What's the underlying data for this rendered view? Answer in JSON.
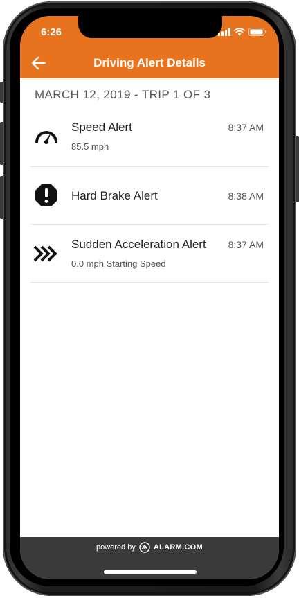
{
  "status_bar": {
    "time": "6:26",
    "icons": [
      "signal-icon",
      "wifi-icon",
      "battery-icon"
    ]
  },
  "header": {
    "title": "Driving Alert Details",
    "back_icon": "arrow-left-icon",
    "color": "#e8731f"
  },
  "trip": {
    "heading": "MARCH 12, 2019 - TRIP 1 OF 3"
  },
  "alerts": [
    {
      "title": "Speed Alert",
      "subtitle": "85.5 mph",
      "time": "8:37 AM",
      "icon": "speedometer-icon"
    },
    {
      "title": "Hard Brake Alert",
      "subtitle": "",
      "time": "8:38 AM",
      "icon": "exclamation-octagon-icon"
    },
    {
      "title": "Sudden Acceleration Alert",
      "subtitle": "0.0 mph Starting Speed",
      "time": "8:37 AM",
      "icon": "triple-chevron-icon"
    }
  ],
  "footer": {
    "powered_by": "powered by",
    "brand": "ALARM.COM",
    "logo_icon": "alarm-com-logo-icon",
    "background": "#3a3a3a"
  }
}
